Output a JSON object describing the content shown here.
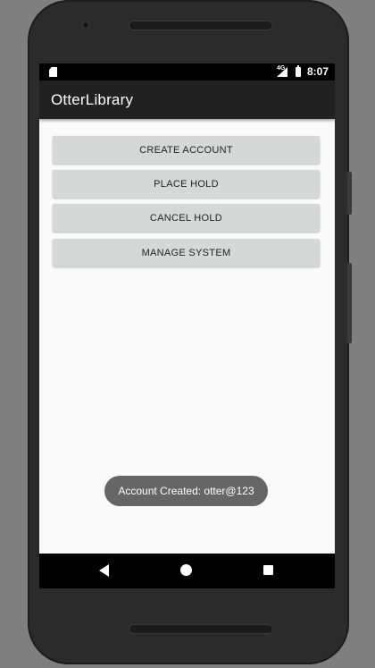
{
  "status_bar": {
    "network": "4G",
    "time": "8:07",
    "icons": [
      "sd-card-icon",
      "signal-icon",
      "battery-icon"
    ]
  },
  "app_bar": {
    "title": "OtterLibrary"
  },
  "buttons": [
    {
      "label": "CREATE ACCOUNT"
    },
    {
      "label": "PLACE HOLD"
    },
    {
      "label": "CANCEL HOLD"
    },
    {
      "label": "MANAGE SYSTEM"
    }
  ],
  "toast": {
    "message": "Account Created: otter@123"
  },
  "nav_bar": {
    "icons": [
      "back-icon",
      "home-icon",
      "recent-apps-icon"
    ]
  },
  "colors": {
    "app_bar": "#212121",
    "screen_background": "#fafafa",
    "button": "#d6d7d7",
    "toast": "#666666"
  }
}
